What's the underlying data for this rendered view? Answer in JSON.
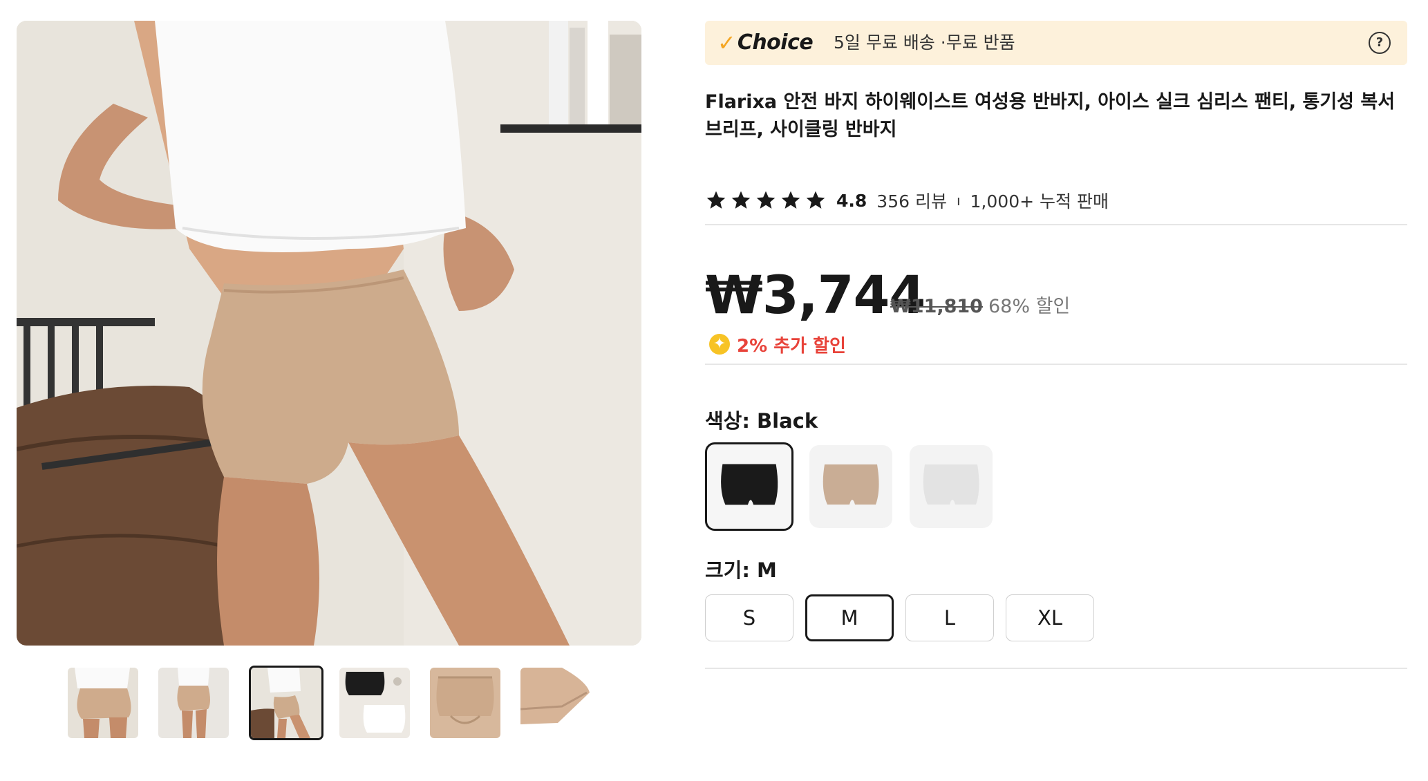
{
  "gallery": {
    "main_image_alt": "",
    "thumbnails": [
      {
        "kind": "model-front"
      },
      {
        "kind": "model-side"
      },
      {
        "kind": "model-pose",
        "selected": true
      },
      {
        "kind": "product-black-white"
      },
      {
        "kind": "product-nude-flat"
      },
      {
        "kind": "product-nude-fold"
      }
    ]
  },
  "choice": {
    "check": "✓",
    "brand": "Choice",
    "text": "5일 무료 배송 ·무료 반품",
    "help": "?"
  },
  "product": {
    "title": "Flarixa 안전 바지 하이웨이스트 여성용 반바지, 아이스 실크 심리스 팬티, 통기성 복서 브리프, 사이클링 반바지",
    "rating": "4.8",
    "rating_stars": 5,
    "reviews": "356 리뷰",
    "separator": "ı",
    "sold": "1,000+ 누적 판매"
  },
  "price": {
    "current": "₩3,744",
    "original": "₩11,810",
    "discount": "68% 할인",
    "coin_symbol": "✦",
    "extra_discount": "2% 추가 할인"
  },
  "color": {
    "label": "색상: Black",
    "options": [
      {
        "name": "Black",
        "hex": "#1a1a1a",
        "selected": true
      },
      {
        "name": "Nude",
        "hex": "#c9ad95",
        "selected": false
      },
      {
        "name": "White",
        "hex": "#f4f4f4",
        "selected": false
      }
    ]
  },
  "size": {
    "label": "크기: M",
    "options": [
      {
        "label": "S",
        "selected": false
      },
      {
        "label": "M",
        "selected": true
      },
      {
        "label": "L",
        "selected": false
      },
      {
        "label": "XL",
        "selected": false
      }
    ]
  },
  "colors": {
    "choice_bg": "#fdf1db",
    "check": "#f5a623",
    "extra_discount": "#e8433a",
    "coin": "#f7c325"
  }
}
